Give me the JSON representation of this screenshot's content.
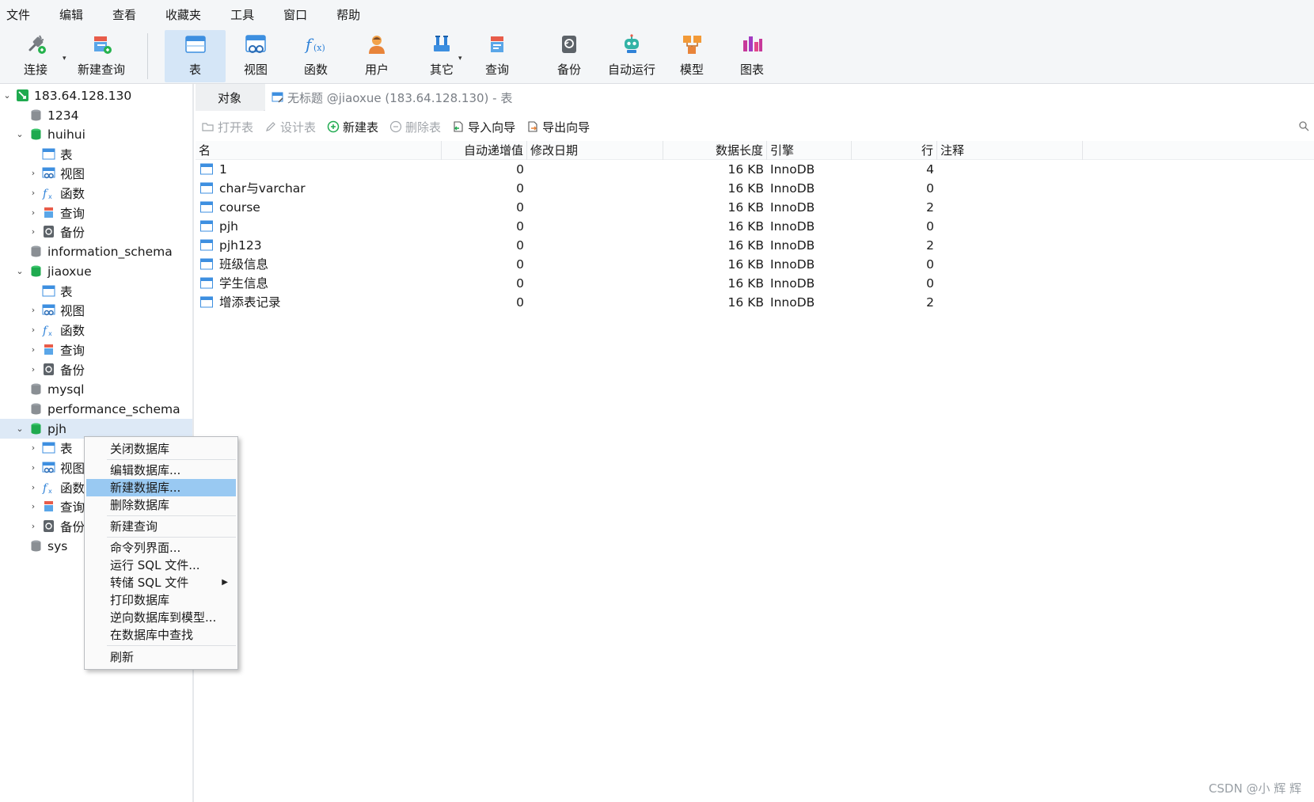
{
  "menubar": {
    "items": [
      "文件",
      "编辑",
      "查看",
      "收藏夹",
      "工具",
      "窗口",
      "帮助"
    ]
  },
  "toolbar": {
    "buttons": [
      {
        "label": "连接",
        "icon": "plug-icon"
      },
      {
        "label": "新建查询",
        "icon": "new-query-icon"
      },
      {
        "label": "表",
        "icon": "table-icon",
        "active": true
      },
      {
        "label": "视图",
        "icon": "view-icon"
      },
      {
        "label": "函数",
        "icon": "function-icon"
      },
      {
        "label": "用户",
        "icon": "user-icon"
      },
      {
        "label": "其它",
        "icon": "tools-icon"
      },
      {
        "label": "查询",
        "icon": "query-icon"
      },
      {
        "label": "备份",
        "icon": "backup-icon"
      },
      {
        "label": "自动运行",
        "icon": "robot-icon"
      },
      {
        "label": "模型",
        "icon": "model-icon"
      },
      {
        "label": "图表",
        "icon": "chart-icon"
      }
    ]
  },
  "tree": {
    "connection": "183.64.128.130",
    "nodes": [
      {
        "label": "1234"
      },
      {
        "label": "huihui"
      },
      {
        "label": "表"
      },
      {
        "label": "视图"
      },
      {
        "label": "函数"
      },
      {
        "label": "查询"
      },
      {
        "label": "备份"
      },
      {
        "label": "information_schema"
      },
      {
        "label": "jiaoxue"
      },
      {
        "label": "表"
      },
      {
        "label": "视图"
      },
      {
        "label": "函数"
      },
      {
        "label": "查询"
      },
      {
        "label": "备份"
      },
      {
        "label": "mysql"
      },
      {
        "label": "performance_schema"
      },
      {
        "label": "pjh"
      },
      {
        "label": "表"
      },
      {
        "label": "视图"
      },
      {
        "label": "函数"
      },
      {
        "label": "查询"
      },
      {
        "label": "备份"
      },
      {
        "label": "sys"
      }
    ]
  },
  "tabs": {
    "objects": "对象",
    "doc": "无标题 @jiaoxue (183.64.128.130) - 表"
  },
  "objtoolbar": {
    "open": "打开表",
    "design": "设计表",
    "new": "新建表",
    "delete": "删除表",
    "import": "导入向导",
    "export": "导出向导"
  },
  "grid": {
    "headers": [
      "名",
      "自动递增值",
      "修改日期",
      "数据长度",
      "引擎",
      "行",
      "注释"
    ],
    "rows": [
      {
        "name": "1",
        "auto_inc": "0",
        "modified": "",
        "length": "16 KB",
        "engine": "InnoDB",
        "rows": "4",
        "comment": ""
      },
      {
        "name": "char与varchar",
        "auto_inc": "0",
        "modified": "",
        "length": "16 KB",
        "engine": "InnoDB",
        "rows": "0",
        "comment": ""
      },
      {
        "name": "course",
        "auto_inc": "0",
        "modified": "",
        "length": "16 KB",
        "engine": "InnoDB",
        "rows": "2",
        "comment": ""
      },
      {
        "name": "pjh",
        "auto_inc": "0",
        "modified": "",
        "length": "16 KB",
        "engine": "InnoDB",
        "rows": "0",
        "comment": ""
      },
      {
        "name": "pjh123",
        "auto_inc": "0",
        "modified": "",
        "length": "16 KB",
        "engine": "InnoDB",
        "rows": "2",
        "comment": ""
      },
      {
        "name": "班级信息",
        "auto_inc": "0",
        "modified": "",
        "length": "16 KB",
        "engine": "InnoDB",
        "rows": "0",
        "comment": ""
      },
      {
        "name": "学生信息",
        "auto_inc": "0",
        "modified": "",
        "length": "16 KB",
        "engine": "InnoDB",
        "rows": "0",
        "comment": ""
      },
      {
        "name": "增添表记录",
        "auto_inc": "0",
        "modified": "",
        "length": "16 KB",
        "engine": "InnoDB",
        "rows": "2",
        "comment": ""
      }
    ]
  },
  "context_menu": {
    "items": [
      {
        "label": "关闭数据库"
      },
      {
        "label": "编辑数据库..."
      },
      {
        "label": "新建数据库...",
        "highlighted": true
      },
      {
        "label": "删除数据库"
      },
      {
        "label": "新建查询"
      },
      {
        "label": "命令列界面..."
      },
      {
        "label": "运行 SQL 文件..."
      },
      {
        "label": "转储 SQL 文件"
      },
      {
        "label": "打印数据库"
      },
      {
        "label": "逆向数据库到模型..."
      },
      {
        "label": "在数据库中查找"
      },
      {
        "label": "刷新"
      }
    ]
  },
  "watermark": "CSDN @小 辉 辉",
  "colors": {
    "db_green": "#1faa4f",
    "db_gray": "#8a8f94",
    "highlight": "#99c9f2",
    "selected_row": "#dde9f6",
    "active_tool": "#d5e6f7"
  }
}
